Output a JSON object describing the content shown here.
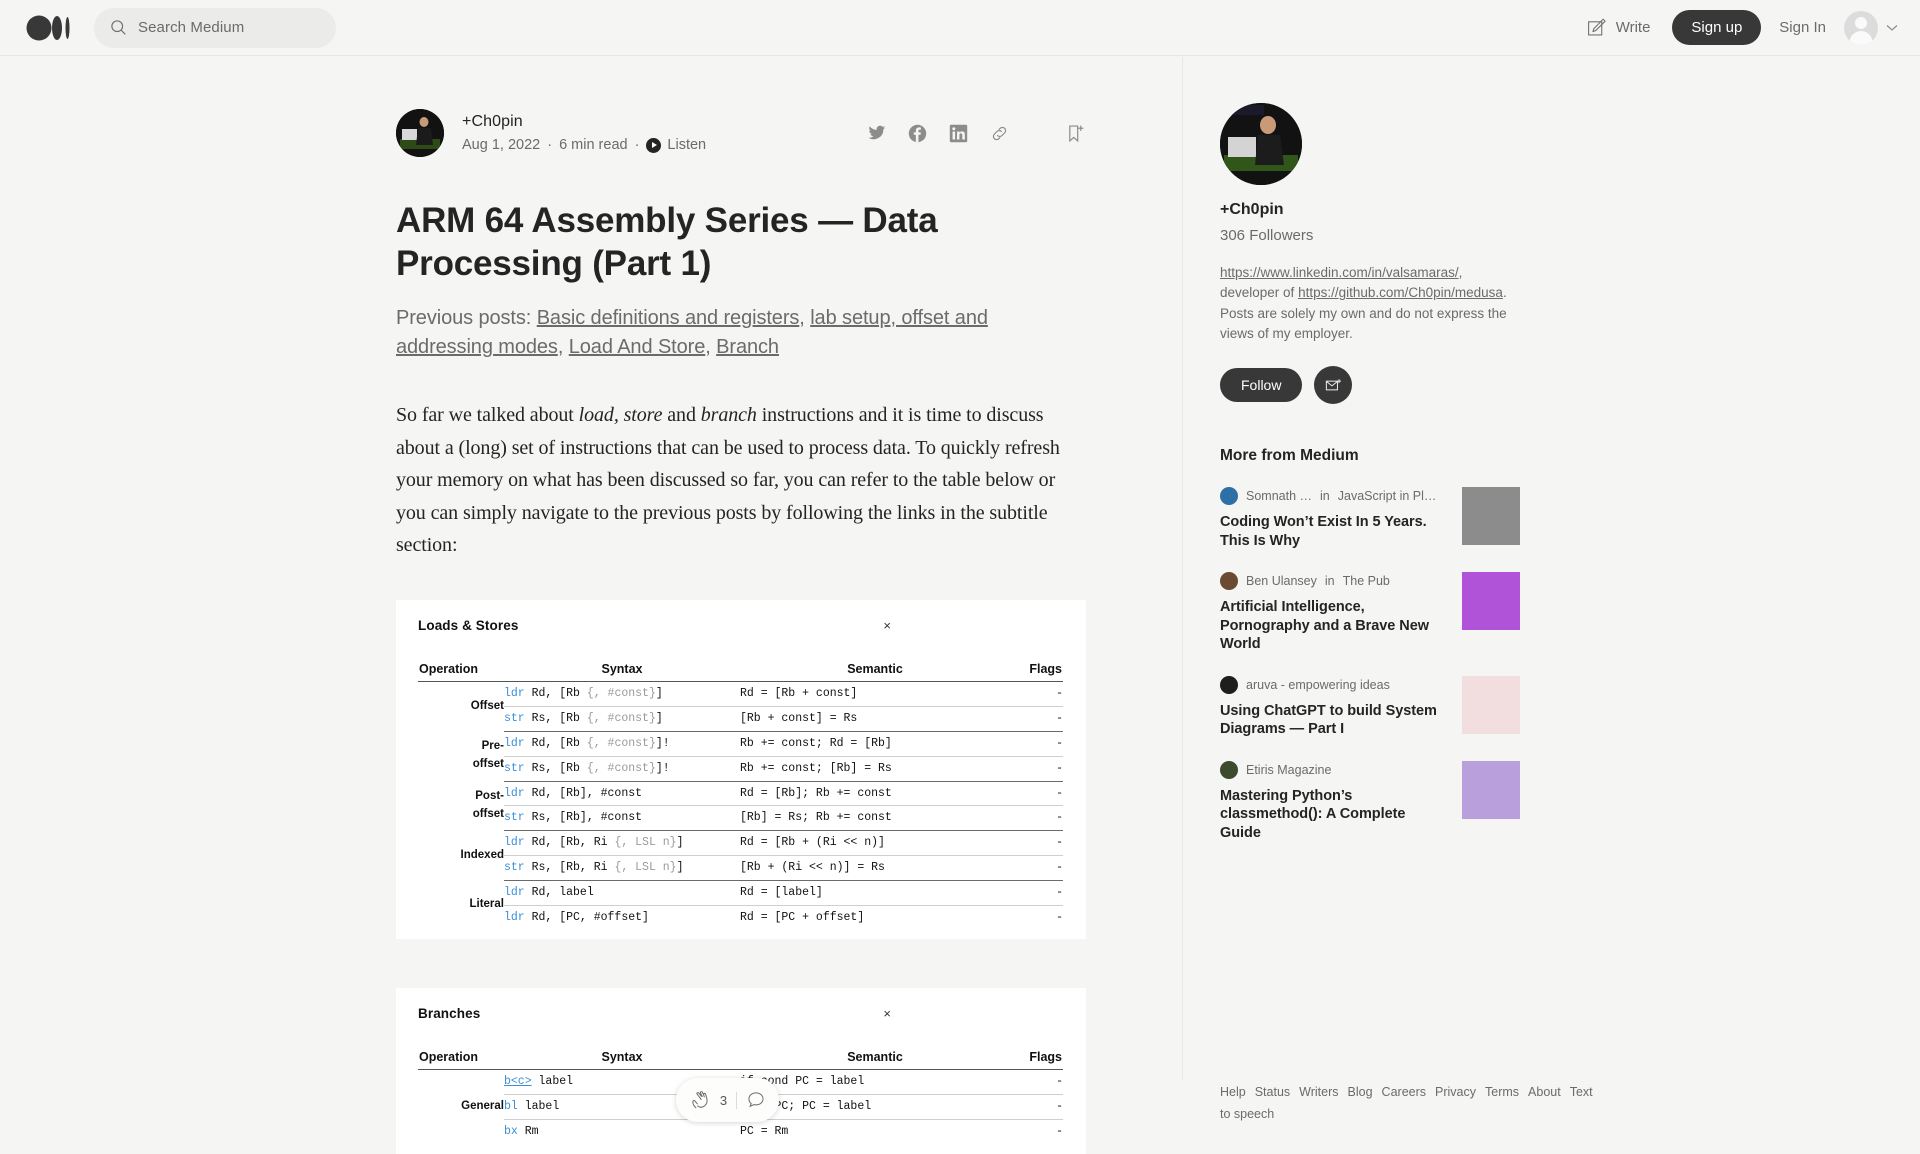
{
  "header": {
    "logo_name": "medium-logo",
    "search_placeholder": "Search Medium",
    "write_label": "Write",
    "signup_label": "Sign up",
    "signin_label": "Sign In"
  },
  "article": {
    "author": "+Ch0pin",
    "date": "Aug 1, 2022",
    "read_time": "6 min read",
    "listen_label": "Listen",
    "separator": "·",
    "title": "ARM 64 Assembly Series — Data Processing (Part 1)",
    "subtitle_prefix": "Previous posts: ",
    "subtitle_links": [
      "Basic definitions and registers",
      "lab setup, offset and addressing modes",
      "Load And Store",
      "Branch"
    ],
    "body_parts": {
      "p1": "So far we talked about ",
      "i1": "load, store",
      "p2": " and ",
      "i2": "branch",
      "p3": " instructions and it is time to discuss about a (long) set of instructions that can be used to process data. To quickly refresh your memory on what has been discussed so far, you can refer to the table below or you can simply navigate to the previous posts by following the links in the subtitle section:"
    }
  },
  "figures": [
    {
      "title": "Loads & Stores",
      "close_label": "×",
      "columns": [
        "Operation",
        "Syntax",
        "Semantic",
        "Flags"
      ],
      "groups": [
        {
          "operation": "Offset",
          "rows": [
            {
              "mnemonic": "ldr",
              "syntax_rest": " Rd, [Rb ",
              "syntax_opt": "{, #const}",
              "syntax_tail": "]",
              "semantic": "Rd = [Rb + const]",
              "flags": "-"
            },
            {
              "mnemonic": "str",
              "syntax_rest": " Rs, [Rb ",
              "syntax_opt": "{, #const}",
              "syntax_tail": "]",
              "semantic": "[Rb + const] = Rs",
              "flags": "-"
            }
          ]
        },
        {
          "operation": "Pre-\noffset",
          "rows": [
            {
              "mnemonic": "ldr",
              "syntax_rest": " Rd, [Rb ",
              "syntax_opt": "{, #const}",
              "syntax_tail": "]!",
              "semantic": "Rb += const; Rd = [Rb]",
              "flags": "-"
            },
            {
              "mnemonic": "str",
              "syntax_rest": " Rs, [Rb ",
              "syntax_opt": "{, #const}",
              "syntax_tail": "]!",
              "semantic": "Rb += const; [Rb] = Rs",
              "flags": "-"
            }
          ]
        },
        {
          "operation": "Post-\noffset",
          "rows": [
            {
              "mnemonic": "ldr",
              "syntax_rest": " Rd, [Rb], #const",
              "syntax_opt": "",
              "syntax_tail": "",
              "semantic": "Rd = [Rb]; Rb += const",
              "flags": "-"
            },
            {
              "mnemonic": "str",
              "syntax_rest": " Rs, [Rb], #const",
              "syntax_opt": "",
              "syntax_tail": "",
              "semantic": "[Rb] = Rs; Rb += const",
              "flags": "-"
            }
          ]
        },
        {
          "operation": "Indexed",
          "rows": [
            {
              "mnemonic": "ldr",
              "syntax_rest": " Rd, [Rb, Ri ",
              "syntax_opt": "{, LSL n}",
              "syntax_tail": "]",
              "semantic": "Rd = [Rb + (Ri << n)]",
              "flags": "-"
            },
            {
              "mnemonic": "str",
              "syntax_rest": " Rs, [Rb, Ri ",
              "syntax_opt": "{, LSL n}",
              "syntax_tail": "]",
              "semantic": "[Rb + (Ri << n)] = Rs",
              "flags": "-"
            }
          ]
        },
        {
          "operation": "Literal",
          "rows": [
            {
              "mnemonic": "ldr",
              "syntax_rest": " Rd, label",
              "syntax_opt": "",
              "syntax_tail": "",
              "semantic": "Rd = [label]",
              "flags": "-"
            },
            {
              "mnemonic": "ldr",
              "syntax_rest": " Rd, [PC, #offset]",
              "syntax_opt": "",
              "syntax_tail": "",
              "semantic": "Rd = [PC + offset]",
              "flags": "-"
            }
          ]
        }
      ]
    },
    {
      "title": "Branches",
      "close_label": "×",
      "columns": [
        "Operation",
        "Syntax",
        "Semantic",
        "Flags"
      ],
      "groups": [
        {
          "operation": "General",
          "rows": [
            {
              "mnemonic": "b<c>",
              "underline": true,
              "syntax_rest": " label",
              "syntax_opt": "",
              "syntax_tail": "",
              "semantic": "if cond PC = label",
              "flags": "-"
            },
            {
              "mnemonic": "bl",
              "syntax_rest": " label",
              "syntax_opt": "",
              "syntax_tail": "",
              "semantic": "LR = PC; PC = label",
              "flags": "-"
            },
            {
              "mnemonic": "bx",
              "syntax_rest": " Rm",
              "syntax_opt": "",
              "syntax_tail": "",
              "semantic": "PC = Rm",
              "flags": "-"
            }
          ]
        }
      ]
    }
  ],
  "clapbar": {
    "count": "3",
    "clap_icon": "clap-icon",
    "comment_icon": "comment-icon"
  },
  "sidebar": {
    "author": "+Ch0pin",
    "followers": "306 Followers",
    "bio_link1": "https://www.linkedin.com/in/valsamaras/",
    "bio_mid": ", developer of ",
    "bio_link2": "https://github.com/Ch0pin/medusa",
    "bio_tail": ". Posts are solely my own and do not express the views of my employer.",
    "follow_label": "Follow",
    "more_title": "More from Medium",
    "recommendations": [
      {
        "author": "Somnath …",
        "in_word": "in",
        "publication": "JavaScript in Plai…",
        "title": "Coding Won’t Exist In 5 Years. This Is Why",
        "thumb": "#8c8c8c"
      },
      {
        "author": "Ben Ulansey",
        "in_word": "in",
        "publication": "The Pub",
        "title": "Artificial Intelligence, Pornography and a Brave New World",
        "thumb": "#b053d8"
      },
      {
        "author": "aruva - empowering ideas",
        "in_word": "",
        "publication": "",
        "title": "Using ChatGPT to build System Diagrams — Part I",
        "thumb": "#f2dede"
      },
      {
        "author": "Etiris Magazine",
        "in_word": "",
        "publication": "",
        "title": "Mastering Python’s classmethod(): A Complete Guide",
        "thumb": "#b9a0dd"
      }
    ],
    "footer_links": [
      "Help",
      "Status",
      "Writers",
      "Blog",
      "Careers",
      "Privacy",
      "Terms",
      "About",
      "Text to speech"
    ]
  },
  "colors": {
    "accent": "#3b8fd8",
    "dark": "#383838",
    "muted": "#6b6b6b",
    "bg": "#f5f5f4"
  }
}
